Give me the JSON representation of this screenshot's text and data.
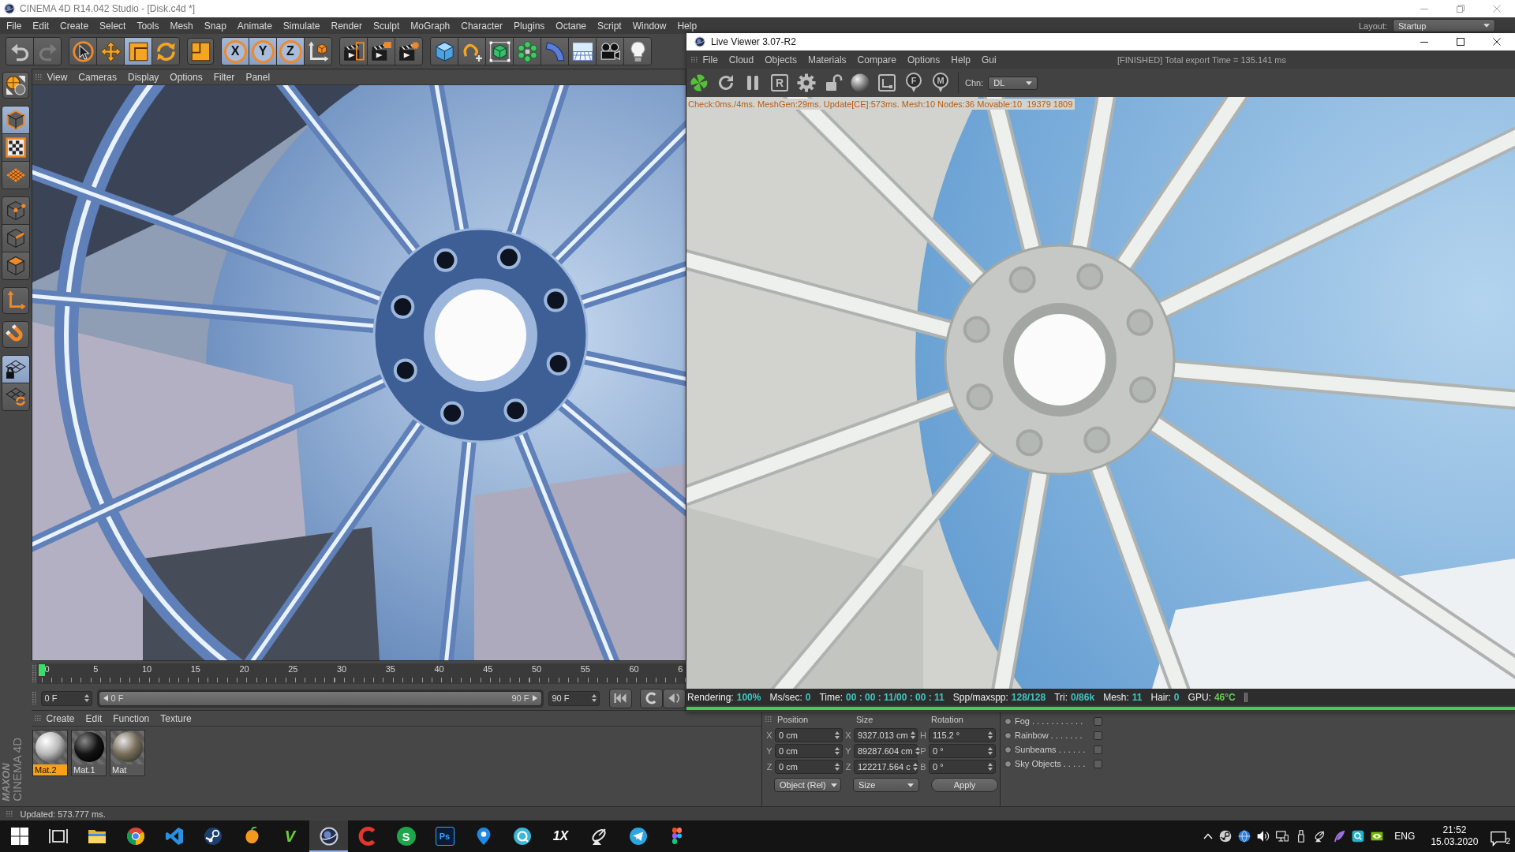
{
  "c4d_window": {
    "title": "CINEMA 4D R14.042 Studio - [Disk.c4d *]",
    "menu": [
      "File",
      "Edit",
      "Create",
      "Select",
      "Tools",
      "Mesh",
      "Snap",
      "Animate",
      "Simulate",
      "Render",
      "Sculpt",
      "MoGraph",
      "Character",
      "Plugins",
      "Octane",
      "Script",
      "Window",
      "Help"
    ],
    "layout_label": "Layout:",
    "layout_value": "Startup"
  },
  "main_toolbar": {
    "groups": [
      {
        "buttons": [
          {
            "kind": "icon",
            "disabled": false
          },
          {
            "kind": "icon",
            "disabled": true
          }
        ]
      },
      {
        "buttons": [
          {
            "kind": "icon",
            "selected": false
          },
          {
            "kind": "icon",
            "selected": false
          },
          {
            "kind": "icon",
            "selected": true
          },
          {
            "kind": "icon",
            "selected": false
          }
        ]
      },
      {
        "buttons": [
          {
            "kind": "icon",
            "selected": false
          }
        ]
      },
      {
        "buttons": [
          {
            "kind": "letter",
            "glyph": "X",
            "selected": true
          },
          {
            "kind": "letter",
            "glyph": "Y",
            "selected": true
          },
          {
            "kind": "letter",
            "glyph": "Z",
            "selected": true
          },
          {
            "kind": "icon",
            "selected": false
          }
        ]
      },
      {
        "buttons": [
          {
            "kind": "icon",
            "selected": false
          },
          {
            "kind": "icon",
            "selected": false
          },
          {
            "kind": "icon",
            "selected": false
          }
        ]
      },
      {
        "buttons": [
          {
            "kind": "icon",
            "selected": false
          },
          {
            "kind": "icon",
            "selected": false
          },
          {
            "kind": "icon",
            "selected": false
          },
          {
            "kind": "icon",
            "selected": false
          },
          {
            "kind": "icon",
            "selected": false
          },
          {
            "kind": "icon",
            "selected": false
          },
          {
            "kind": "icon",
            "selected": false
          },
          {
            "kind": "icon",
            "selected": false
          }
        ]
      }
    ]
  },
  "mode_toolbar": {
    "groups": [
      {
        "buttons": [
          {
            "kind": "icon",
            "selected": false
          }
        ]
      },
      {
        "buttons": [
          {
            "kind": "icon",
            "selected": true
          },
          {
            "kind": "icon",
            "selected": false
          },
          {
            "kind": "icon",
            "selected": false
          }
        ]
      },
      {
        "buttons": [
          {
            "kind": "icon",
            "selected": false
          },
          {
            "kind": "icon",
            "selected": false
          },
          {
            "kind": "icon",
            "selected": false
          }
        ]
      },
      {
        "buttons": [
          {
            "kind": "icon",
            "selected": false
          }
        ]
      },
      {
        "buttons": [
          {
            "kind": "icon",
            "selected": false
          }
        ]
      },
      {
        "buttons": [
          {
            "kind": "icon",
            "selected": true
          },
          {
            "kind": "icon",
            "selected": false
          }
        ]
      }
    ]
  },
  "logo": {
    "brand": "MAXON",
    "product": "CINEMA 4D"
  },
  "viewport": {
    "menu": [
      "View",
      "Cameras",
      "Display",
      "Options",
      "Filter",
      "Panel"
    ]
  },
  "timeline": {
    "labels": [
      "0",
      "5",
      "10",
      "15",
      "20",
      "25",
      "30",
      "35",
      "40",
      "45",
      "50",
      "55",
      "60",
      "6"
    ],
    "level": 0
  },
  "frame_bar": {
    "start_frame": "0 F",
    "range": {
      "start": "0 F",
      "end": "90 F",
      "level": 1
    },
    "end_frame": "90 F"
  },
  "material_manager": {
    "menu": [
      "Create",
      "Edit",
      "Function",
      "Texture"
    ],
    "materials": [
      {
        "name": "Mat.2",
        "selected": true
      },
      {
        "name": "Mat.1",
        "selected": false
      },
      {
        "name": "Mat",
        "selected": false
      }
    ]
  },
  "coordinates": {
    "headers": [
      "Position",
      "Size",
      "Rotation"
    ],
    "rows": [
      {
        "position_axis": "X",
        "position": "0 cm",
        "size_axis": "X",
        "size": "9327.013 cm",
        "rotation_axis": "H",
        "rotation": "115.2 °"
      },
      {
        "position_axis": "Y",
        "position": "0 cm",
        "size_axis": "Y",
        "size": "89287.604 cm",
        "rotation_axis": "P",
        "rotation": "0 °"
      },
      {
        "position_axis": "Z",
        "position": "0 cm",
        "size_axis": "Z",
        "size": "122217.564 c",
        "rotation_axis": "B",
        "rotation": "0 °"
      }
    ],
    "mode": "Object (Rel)",
    "size_mode": "Size",
    "apply": "Apply"
  },
  "attributes": {
    "rows": [
      {
        "label": "Fog . . . . . . . . . . .",
        "checked": false
      },
      {
        "label": "Rainbow . . . . . . .",
        "checked": false
      },
      {
        "label": "Sunbeams . . . . . .",
        "checked": false
      },
      {
        "label": "Sky Objects . . . . .",
        "checked": false
      }
    ]
  },
  "status_bar": {
    "text": "Updated: 573.777 ms."
  },
  "live_viewer": {
    "title": "Live Viewer 3.07-R2",
    "menu": [
      "File",
      "Cloud",
      "Objects",
      "Materials",
      "Compare",
      "Options",
      "Help",
      "Gui"
    ],
    "export_status": "[FINISHED] Total export Time = 135.141 ms",
    "toolbar": {
      "buttons": [
        {
          "kind": "icon"
        },
        {
          "kind": "icon"
        },
        {
          "kind": "icon"
        },
        {
          "kind": "letter",
          "glyph": "R"
        },
        {
          "kind": "icon"
        },
        {
          "kind": "icon"
        },
        {
          "kind": "icon"
        },
        {
          "kind": "icon"
        },
        {
          "kind": "letter",
          "glyph": "F"
        },
        {
          "kind": "letter",
          "glyph": "M"
        }
      ]
    },
    "channel_label": "Chn:",
    "channel_value": "DL",
    "stats_line": "Check:0ms./4ms. MeshGen:29ms. Update[CE]:573ms. Mesh:10 Nodes:36 Movable:10  19379 1809",
    "render_status": [
      {
        "label": "Rendering:",
        "value": "100%",
        "color": "#3fc6c0"
      },
      {
        "label": "Ms/sec:",
        "value": "0",
        "color": "#3fc6c0"
      },
      {
        "label": "Time:",
        "value": "00 : 00 : 11/00 : 00 : 11",
        "color": "#3fc6c0"
      },
      {
        "label": "Spp/maxspp:",
        "value": "128/128",
        "color": "#3fc6c0"
      },
      {
        "label": "Tri:",
        "value": "0/86k",
        "color": "#3fc6c0"
      },
      {
        "label": "Mesh:",
        "value": "11",
        "color": "#3fc6c0"
      },
      {
        "label": "Hair:",
        "value": "0",
        "color": "#3fc6c0"
      },
      {
        "label": "GPU:",
        "value": "46°C",
        "color": "#63cf52"
      }
    ],
    "progress": {
      "level": 1
    }
  },
  "taskbar": {
    "apps": [
      {
        "kind": "icon",
        "selected": false
      },
      {
        "kind": "icon",
        "selected": false
      },
      {
        "kind": "icon",
        "selected": false
      },
      {
        "kind": "icon",
        "selected": false
      },
      {
        "kind": "icon",
        "selected": false
      },
      {
        "kind": "icon",
        "selected": false
      },
      {
        "kind": "icon",
        "selected": false
      },
      {
        "kind": "letter",
        "glyph": "V",
        "selected": false
      },
      {
        "kind": "icon",
        "selected": true
      },
      {
        "kind": "icon",
        "selected": false
      },
      {
        "kind": "letter",
        "glyph": "S",
        "selected": false
      },
      {
        "kind": "letter",
        "glyph": "Ps",
        "selected": false
      },
      {
        "kind": "icon",
        "selected": false
      },
      {
        "kind": "icon",
        "selected": false
      },
      {
        "kind": "letter",
        "glyph": "1X",
        "selected": false
      },
      {
        "kind": "icon",
        "selected": false
      },
      {
        "kind": "icon",
        "selected": false
      },
      {
        "kind": "icon",
        "selected": false
      }
    ],
    "tray": {
      "language": "ENG",
      "time": "21:52",
      "date": "15.03.2020",
      "notifications": "2"
    }
  }
}
